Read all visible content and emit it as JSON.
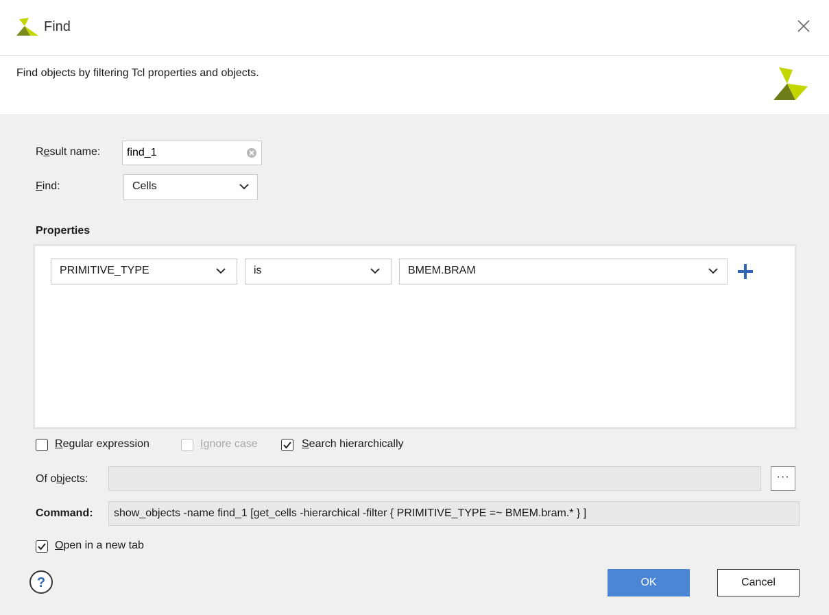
{
  "window": {
    "title": "Find",
    "close_icon": "close-icon",
    "logo_icon": "xilinx-logo-icon"
  },
  "description": "Find objects by filtering Tcl properties and objects.",
  "result_name": {
    "label_mnemonic": "e",
    "label_pre": "R",
    "label_post": "sult name:",
    "value": "find_1"
  },
  "find": {
    "label_mnemonic": "F",
    "label_post": "ind:",
    "selected": "Cells"
  },
  "properties": {
    "title": "Properties",
    "filter": {
      "property": "PRIMITIVE_TYPE",
      "operator": "is",
      "value": "BMEM.BRAM"
    },
    "add_icon": "plus-icon"
  },
  "options": {
    "regex": {
      "mnemonic": "R",
      "rest": "egular expression",
      "checked": false
    },
    "ignore_case": {
      "mnemonic": "I",
      "rest": "gnore case",
      "checked": false,
      "enabled": false
    },
    "search_hier": {
      "mnemonic": "S",
      "rest": "earch hierarchically",
      "checked": true
    }
  },
  "of_objects": {
    "label_pre": "Of o",
    "label_mnemonic": "b",
    "label_post": "jects:",
    "value": "",
    "browse_label": "···"
  },
  "command": {
    "label": "Command:",
    "value": "show_objects -name find_1 [get_cells -hierarchical -filter { PRIMITIVE_TYPE =~ BMEM.bram.* } ]"
  },
  "open_new_tab": {
    "mnemonic": "O",
    "rest": "pen in a new tab",
    "checked": true
  },
  "buttons": {
    "help": "?",
    "ok": "OK",
    "cancel": "Cancel"
  },
  "colors": {
    "ok_button": "#4a86d4",
    "logo_light": "#c4d600",
    "logo_dark": "#6f7c1a"
  }
}
